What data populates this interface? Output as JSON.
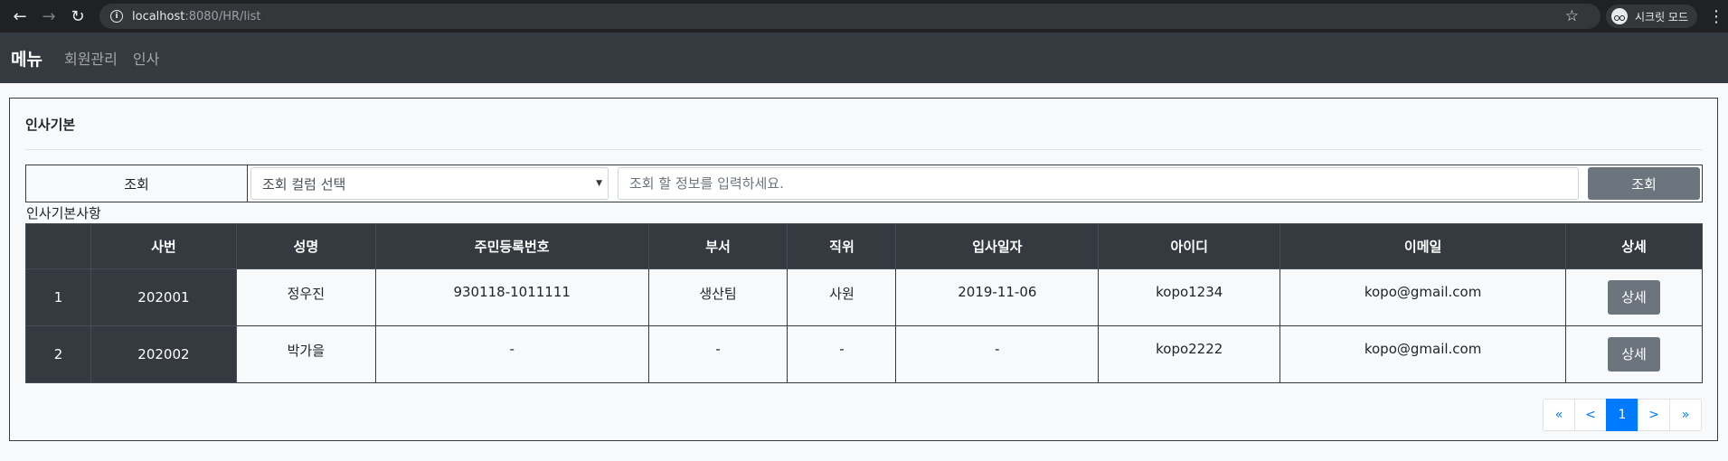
{
  "browser": {
    "url_host": "localhost",
    "url_rest": ":8080/HR/list",
    "incognito_label": "시크릿 모드"
  },
  "navbar": {
    "brand": "메뉴",
    "links": [
      "회원관리",
      "인사"
    ]
  },
  "card": {
    "title": "인사기본",
    "search": {
      "label": "조회",
      "select_value": "조회 컬럼 선택",
      "input_placeholder": "조회 할 정보를 입력하세요.",
      "button_label": "조회"
    },
    "table_caption": "인사기본사항",
    "table": {
      "headers": [
        "",
        "사번",
        "성명",
        "주민등록번호",
        "부서",
        "직위",
        "입사일자",
        "아이디",
        "이메일",
        "상세"
      ],
      "rows": [
        {
          "no": "1",
          "emp_id": "202001",
          "name": "정우진",
          "rrn": "930118-1011111",
          "dept": "생산팀",
          "position": "사원",
          "hire_date": "2019-11-06",
          "user_id": "kopo1234",
          "email": "kopo@gmail.com",
          "detail": "상세"
        },
        {
          "no": "2",
          "emp_id": "202002",
          "name": "박가을",
          "rrn": "-",
          "dept": "-",
          "position": "-",
          "hire_date": "-",
          "user_id": "kopo2222",
          "email": "kopo@gmail.com",
          "detail": "상세"
        }
      ]
    },
    "pagination": {
      "first": "«",
      "prev": "<",
      "current": "1",
      "next": ">",
      "last": "»"
    }
  },
  "colors": {
    "navbar_bg": "#343a40",
    "secondary_btn": "#6c757d",
    "primary": "#007bff"
  }
}
